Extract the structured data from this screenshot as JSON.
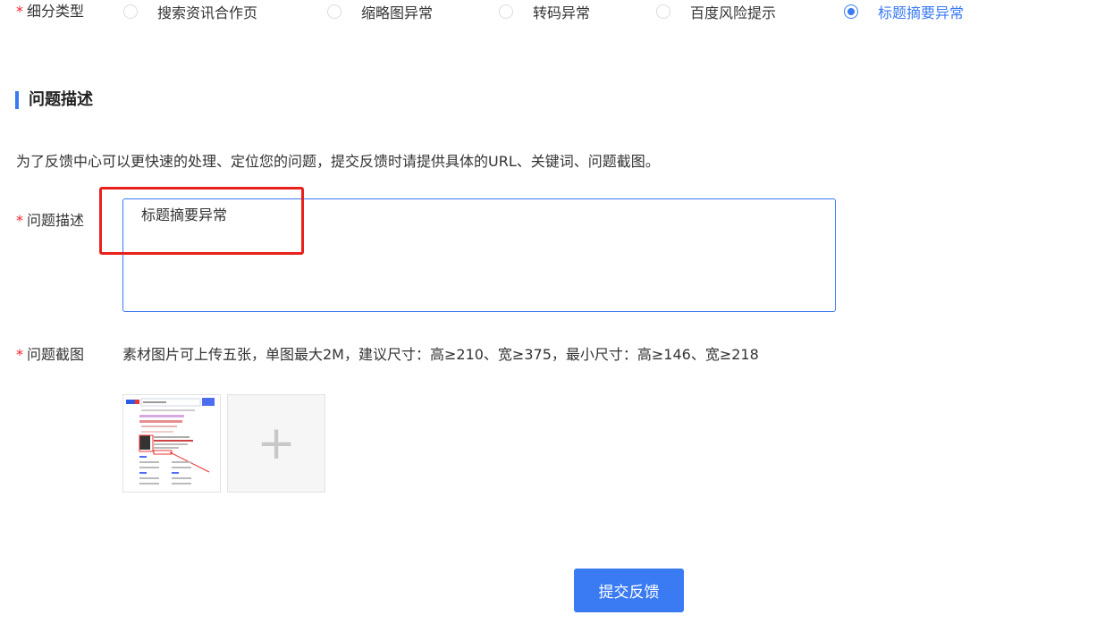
{
  "required_mark": "*",
  "subtype": {
    "label": "细分类型",
    "options": [
      {
        "label": "搜索资讯合作页",
        "selected": false
      },
      {
        "label": "缩略图异常",
        "selected": false
      },
      {
        "label": "转码异常",
        "selected": false
      },
      {
        "label": "百度风险提示",
        "selected": false
      },
      {
        "label": "标题摘要异常",
        "selected": true
      }
    ]
  },
  "section": {
    "title": "问题描述",
    "hint": "为了反馈中心可以更快速的处理、定位您的问题，提交反馈时请提供具体的URL、关键词、问题截图。"
  },
  "description": {
    "label": "问题描述",
    "value": "标题摘要异常"
  },
  "screenshot": {
    "label": "问题截图",
    "hint": "素材图片可上传五张，单图最大2M，建议尺寸：高≥210、宽≥375，最小尺寸：高≥146、宽≥218",
    "add_symbol": "+"
  },
  "submit_label": "提交反馈",
  "colors": {
    "accent": "#3a7af2",
    "required": "#f5222d",
    "annotation": "#e8211c"
  }
}
